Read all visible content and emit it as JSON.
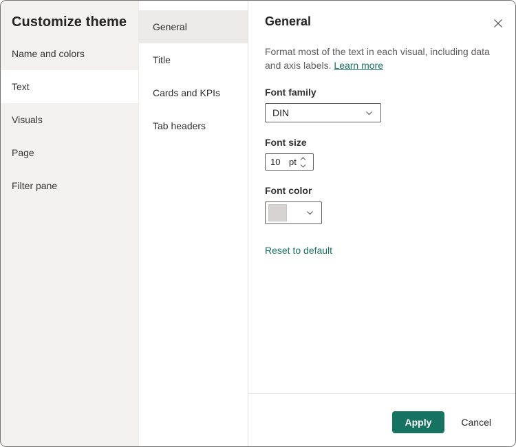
{
  "dialog_title": "Customize theme",
  "sidebar": {
    "items": [
      {
        "label": "Name and colors",
        "selected": false
      },
      {
        "label": "Text",
        "selected": true
      },
      {
        "label": "Visuals",
        "selected": false
      },
      {
        "label": "Page",
        "selected": false
      },
      {
        "label": "Filter pane",
        "selected": false
      }
    ]
  },
  "subnav": {
    "items": [
      {
        "label": "General",
        "selected": true
      },
      {
        "label": "Title",
        "selected": false
      },
      {
        "label": "Cards and KPIs",
        "selected": false
      },
      {
        "label": "Tab headers",
        "selected": false
      }
    ]
  },
  "panel": {
    "heading": "General",
    "description": "Format most of the text in each visual, including data and axis labels.",
    "learn_more_label": "Learn more",
    "font_family": {
      "label": "Font family",
      "value": "DIN"
    },
    "font_size": {
      "label": "Font size",
      "value": "10",
      "unit": "pt"
    },
    "font_color": {
      "label": "Font color",
      "swatch_color": "#d6d4d2"
    },
    "reset_label": "Reset to default",
    "footer": {
      "apply_label": "Apply",
      "cancel_label": "Cancel"
    }
  },
  "colors": {
    "accent_teal": "#177361",
    "sidebar_bg": "#f3f2f1",
    "sidebar_selected_bg": "#ffffff",
    "subnav_selected_bg": "#edebe9",
    "divider": "#e1dfdd",
    "control_border": "#605e5c",
    "text_primary": "#252423",
    "text_secondary": "#605e5c"
  },
  "icons": {
    "close": "close-icon",
    "dropdown_chevron": "chevron-down-icon",
    "spinner_up": "chevron-up-icon",
    "spinner_down": "chevron-down-icon"
  }
}
